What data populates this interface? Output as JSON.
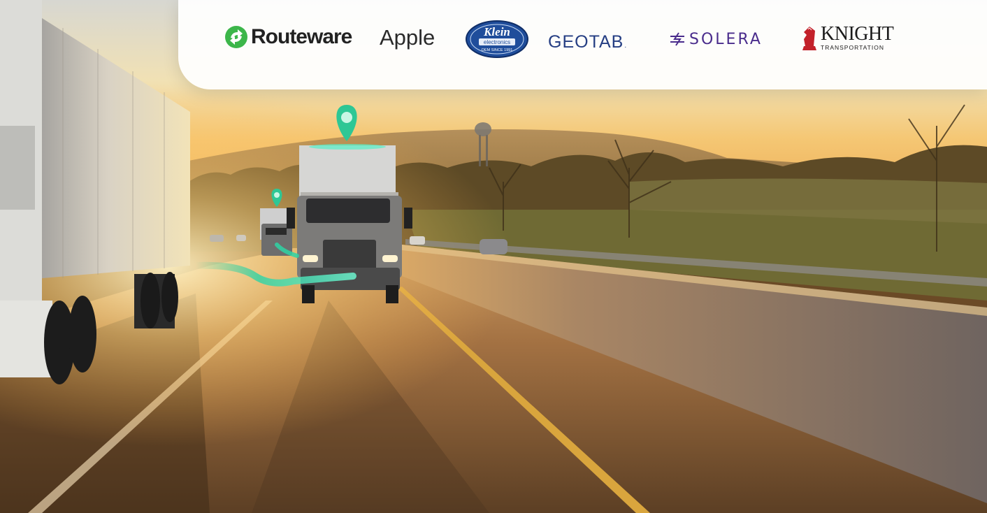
{
  "logos": {
    "routeware": "Routeware",
    "apple": "Apple",
    "klein": {
      "name": "Klein",
      "line2": "electronics",
      "tagline": "OEM SINCE 1991"
    },
    "geotab": "GEOTAB",
    "geotab_mark": ".",
    "solera": "SOLERA",
    "knight": {
      "name": "KNIGHT",
      "sub": "TRANSPORTATION"
    }
  },
  "colors": {
    "routeware_green": "#3cb64a",
    "geotab_blue": "#253e83",
    "solera_purple": "#4a2c8c",
    "knight_red": "#c3212a",
    "tracking_teal": "#2ed3a5"
  },
  "icons": [
    "location-pin-icon",
    "location-pin-icon",
    "tracking-route-icon"
  ]
}
